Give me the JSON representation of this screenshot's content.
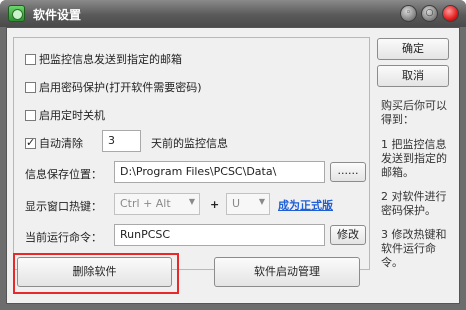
{
  "window": {
    "title": "软件设置",
    "min_glyph": "◦",
    "restore_glyph": "○",
    "close_glyph": ""
  },
  "options": {
    "send_to_email": "把监控信息发送到指定的邮箱",
    "password_protect": "启用密码保护(打开软件需要密码)",
    "scheduled_shutdown": "启用定时关机",
    "auto_clear": "自动清除",
    "auto_clear_days": "3",
    "auto_clear_suffix": "天前的监控信息"
  },
  "save_location": {
    "label": "信息保存位置：",
    "value": "D:\\Program Files\\PCSC\\Data\\",
    "browse_label": "......"
  },
  "hotkey": {
    "label": "显示窗口热键：",
    "modifier": "Ctrl + Alt",
    "plus": "+",
    "key": "U",
    "register_link": "成为正式版"
  },
  "run_command": {
    "label": "当前运行命令：",
    "value": "RunPCSC",
    "edit_label": "修改"
  },
  "buttons": {
    "delete_software": "删除软件",
    "startup_manager": "软件启动管理",
    "ok": "确定",
    "cancel": "取消"
  },
  "side_info": {
    "intro": "购买后你可以得到：",
    "item1": "1 把监控信息发送到指定的邮箱。",
    "item2": "2 对软件进行密码保护。",
    "item3": "3 修改热键和软件运行命令。"
  },
  "colors": {
    "title_bar": "#5a5a5a",
    "link": "#1f5fd6",
    "highlight_border": "#e8282a"
  }
}
